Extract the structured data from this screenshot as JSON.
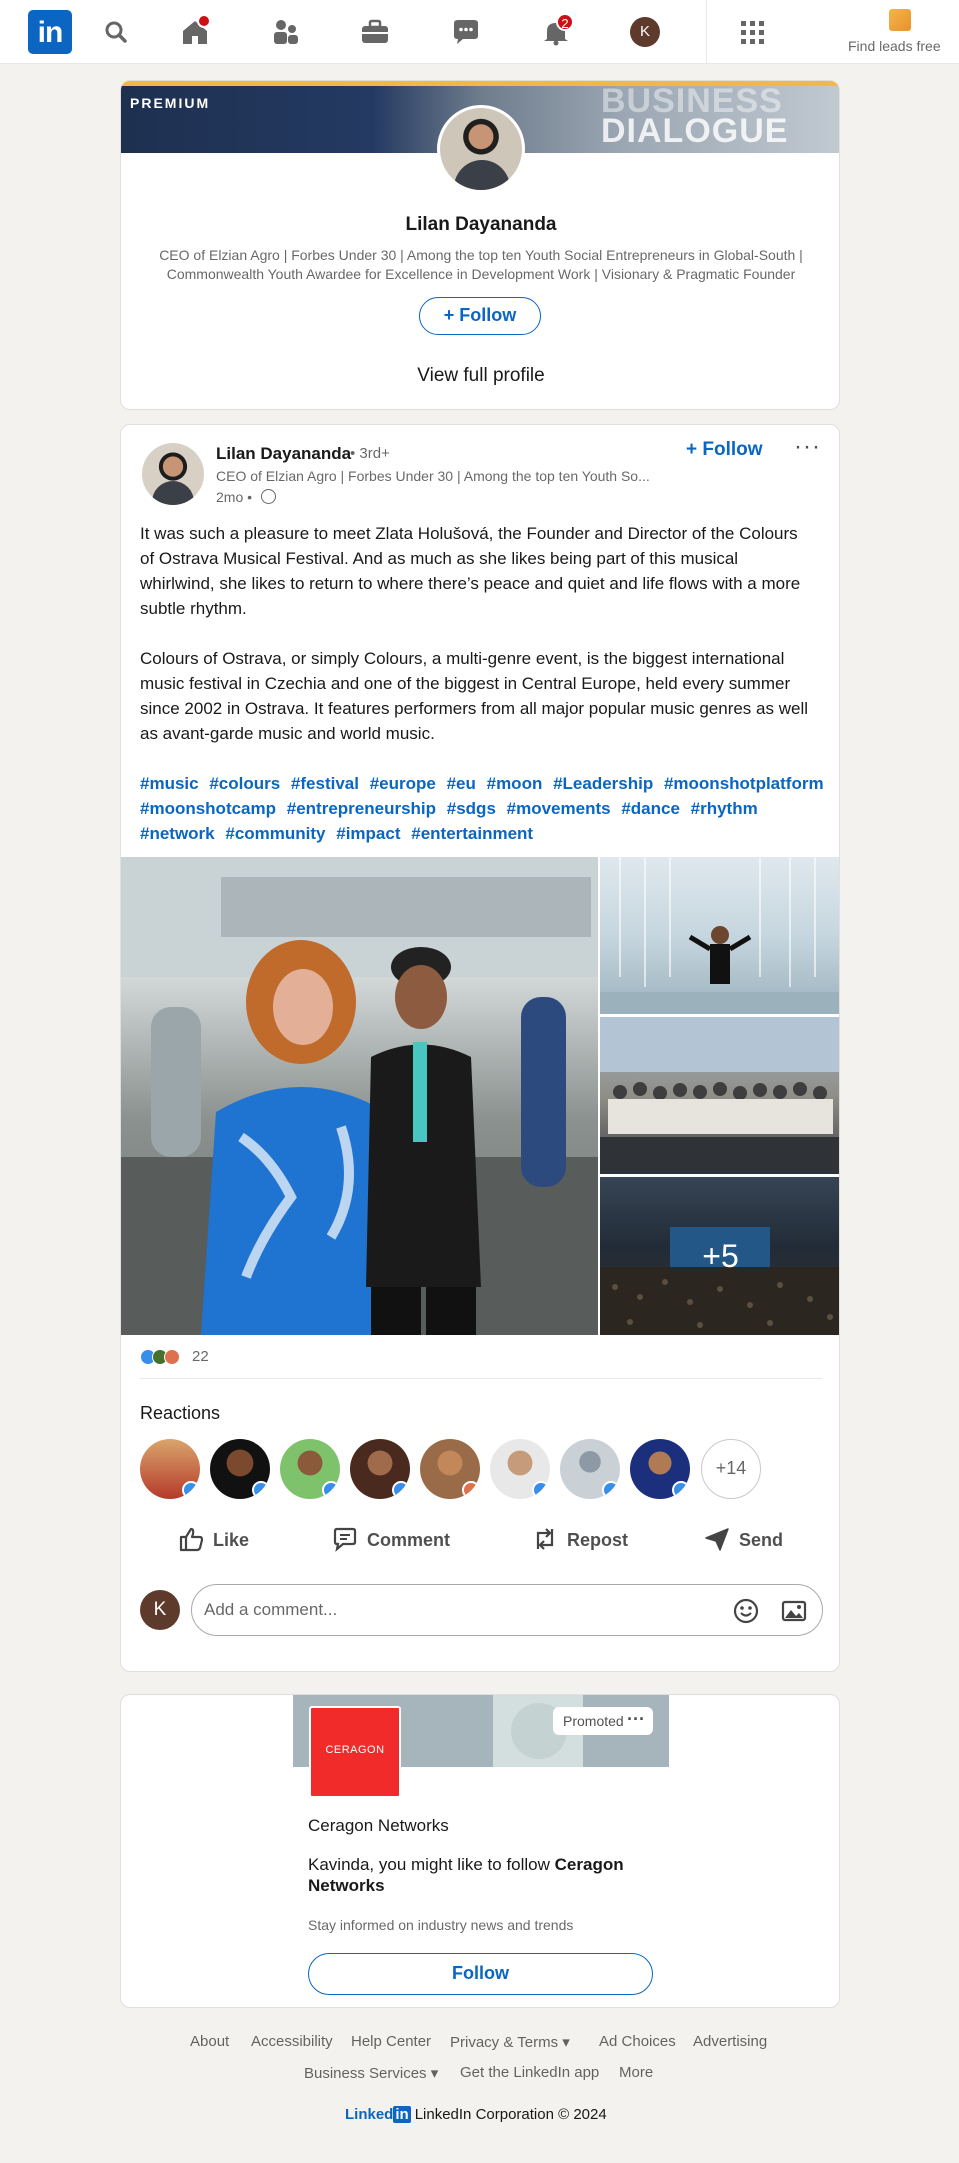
{
  "nav": {
    "logo": "in",
    "home_badge": "",
    "notifications_badge": "2",
    "avatar_initial": "K",
    "find_leads": "Find leads free"
  },
  "profile_card": {
    "premium_label": "PREMIUM",
    "banner_text_1": "BUSINESS",
    "banner_text_2": "DIALOGUE",
    "name": "Lilan Dayananda",
    "headline": "CEO of Elzian Agro | Forbes Under 30 | Among the top ten Youth Social Entrepreneurs in Global-South | Commonwealth Youth Awardee for Excellence in Development Work | Visionary & Pragmatic Founder",
    "follow_label": "Follow",
    "view_profile_label": "View full profile"
  },
  "post": {
    "author": "Lilan Dayananda",
    "degree": "• 3rd+",
    "author_headline": "CEO of Elzian Agro | Forbes Under 30 | Among the top ten Youth So...",
    "timestamp": "2mo •",
    "follow_label": "Follow",
    "more_label": "···",
    "paragraph_1": "It was such a pleasure to meet Zlata Holušová, the Founder and Director of the Colours of Ostrava Musical Festival. And as much as she likes being part of this musical whirlwind, she likes to return to where there’s peace and quiet and life flows with a more subtle rhythm.",
    "paragraph_2": "Colours of Ostrava, or simply Colours, a multi-genre event, is the biggest international music festival in Czechia and one of the biggest in Central Europe, held every summer since 2002 in Ostrava. It features performers from all major popular music genres as well as avant-garde music and world music.",
    "hashtags": [
      "#music",
      "#colours",
      "#festival",
      "#europe",
      "#eu",
      "#moon",
      "#Leadership",
      "#moonshotplatform",
      "#moonshotcamp",
      "#entrepreneurship",
      "#sdgs",
      "#movements",
      "#dance",
      "#rhythm",
      "#network",
      "#community",
      "#impact",
      "#entertainment"
    ],
    "more_photos": "+5",
    "reaction_count": "22",
    "reactions_title": "Reactions",
    "reactions_more": "+14",
    "actions": {
      "like": "Like",
      "comment": "Comment",
      "repost": "Repost",
      "send": "Send"
    },
    "comment_avatar_initial": "K",
    "comment_placeholder": "Add a comment..."
  },
  "ad": {
    "promoted_label": "Promoted",
    "logo_text": "CERAGON",
    "company": "Ceragon Networks",
    "message_prefix": "Kavinda, you might like to follow",
    "message_company": "Ceragon Networks",
    "subtext": "Stay informed on industry news and trends",
    "follow_label": "Follow"
  },
  "footer": {
    "links_row1": [
      "About",
      "Accessibility",
      "Help Center",
      "Privacy & Terms ▾",
      "Ad Choices",
      "Advertising"
    ],
    "links_row2": [
      "Business Services ▾",
      "Get the LinkedIn app",
      "More"
    ],
    "brand_word": "Linked",
    "brand_in": "in",
    "copyright": "LinkedIn Corporation © 2024"
  },
  "colors": {
    "brand_blue": "#0a66c2",
    "badge_red": "#cc1016",
    "page_bg": "#f4f2ee"
  }
}
